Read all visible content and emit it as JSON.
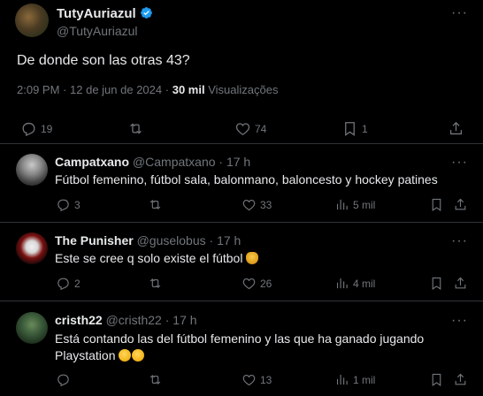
{
  "main_tweet": {
    "author_name": "TutyAuriazul",
    "author_handle": "@TutyAuriazul",
    "text": "De donde son las otras 43?",
    "time": "2:09 PM",
    "date": "12 de jun de 2024",
    "dot": "·",
    "views_count": "30 mil",
    "views_label": "Visualizações",
    "reply_count": "19",
    "like_count": "74",
    "bookmark_count": "1"
  },
  "replies": [
    {
      "name": "Campatxano",
      "handle": "@Campatxano",
      "dot": "·",
      "time": "17 h",
      "text": "Fútbol femenino, fútbol sala, balonmano, baloncesto y hockey patines",
      "reply_count": "3",
      "like_count": "33",
      "views": "5 mil"
    },
    {
      "name": "The Punisher",
      "handle": "@guselobus",
      "dot": "·",
      "time": "17 h",
      "text": "Este se cree q solo existe el fútbol",
      "reply_count": "2",
      "like_count": "26",
      "views": "4 mil"
    },
    {
      "name": "cristh22",
      "handle": "@cristh22",
      "dot": "·",
      "time": "17 h",
      "text": "Está contando las del fútbol femenino y las que ha ganado jugando Playstation",
      "reply_count": "",
      "like_count": "13",
      "views": "1 mil"
    }
  ],
  "colors": {
    "background": "#000000",
    "text_primary": "#e7e9ea",
    "text_secondary": "#71767b",
    "divider": "#2f3336",
    "verified": "#1d9bf0"
  }
}
